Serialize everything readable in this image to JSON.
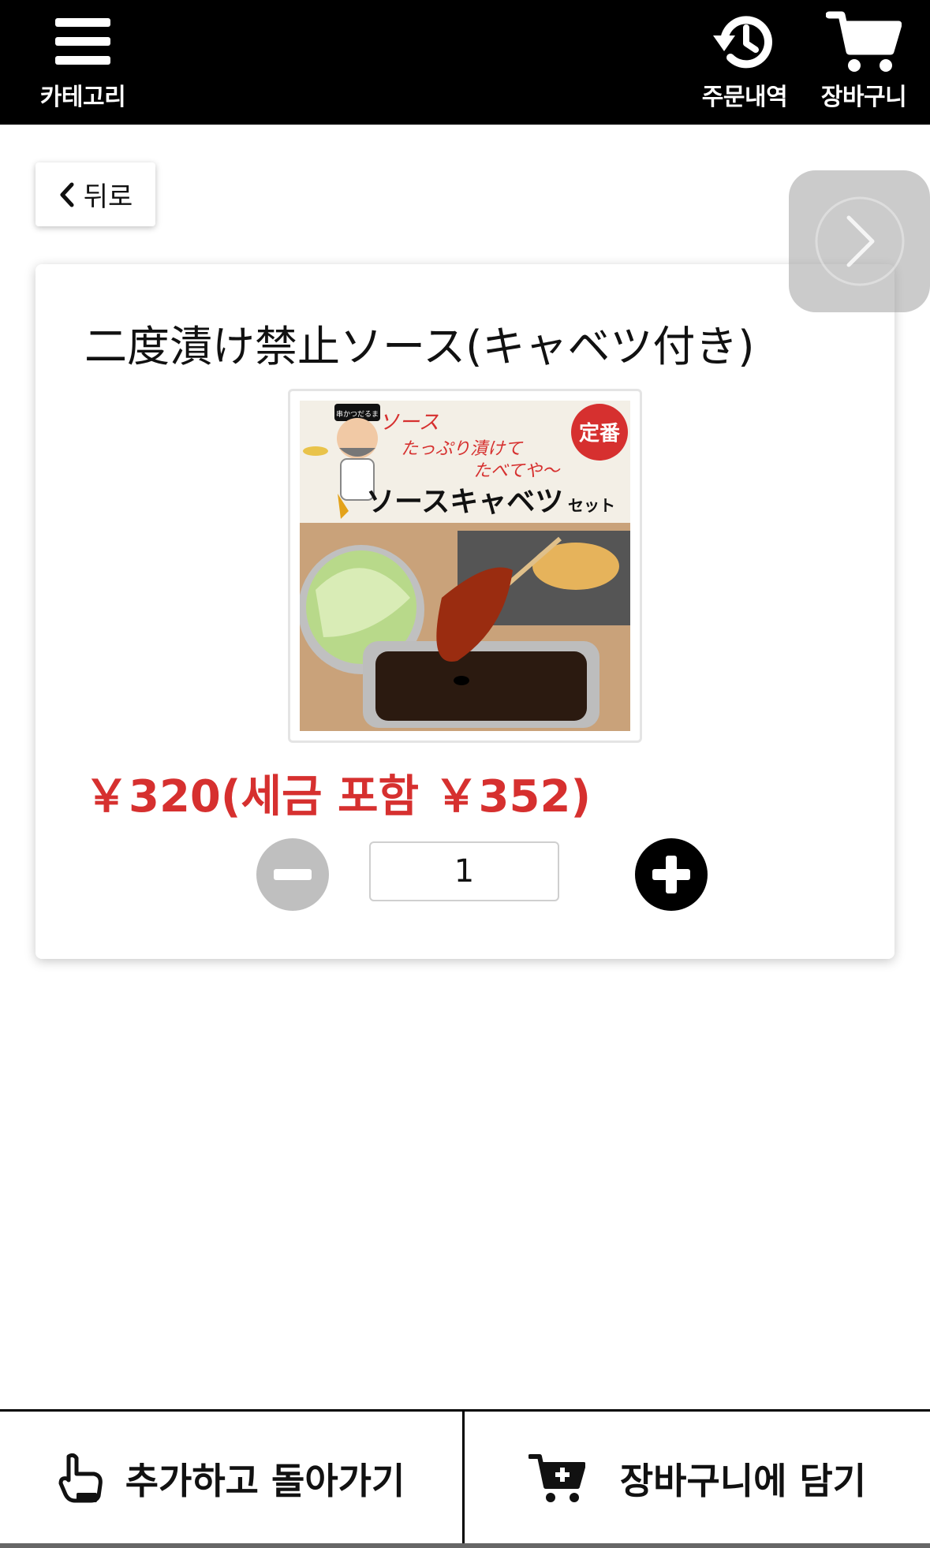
{
  "header": {
    "category_label": "카테고리",
    "history_label": "주문내역",
    "cart_label": "장바구니"
  },
  "nav": {
    "back_label": "뒤로"
  },
  "product": {
    "title": "二度漬け禁止ソース(キャベツ付き)",
    "price_text": "￥320(세금 포함 ￥352)",
    "quantity": "1",
    "image": {
      "brand_logo_text": "串かつだるま",
      "tagline": "ソース たっぷり漬けて たべてや〜",
      "stamp_text": "定番",
      "headline": "ソースキャベツ",
      "headline_suffix": "セット"
    }
  },
  "footer": {
    "add_and_return_label": "추가하고 돌아가기",
    "add_to_cart_label": "장바구니에 담기"
  },
  "colors": {
    "header_bg": "#000000",
    "price": "#d6302f",
    "minus_disabled": "#bfbfbf",
    "plus": "#000000"
  },
  "icons": {
    "category": "menu-icon",
    "history": "history-icon",
    "cart": "cart-icon",
    "back": "chevron-left-icon",
    "next": "chevron-right-icon",
    "add_return": "pointing-hand-icon",
    "add_cart": "cart-plus-icon"
  }
}
